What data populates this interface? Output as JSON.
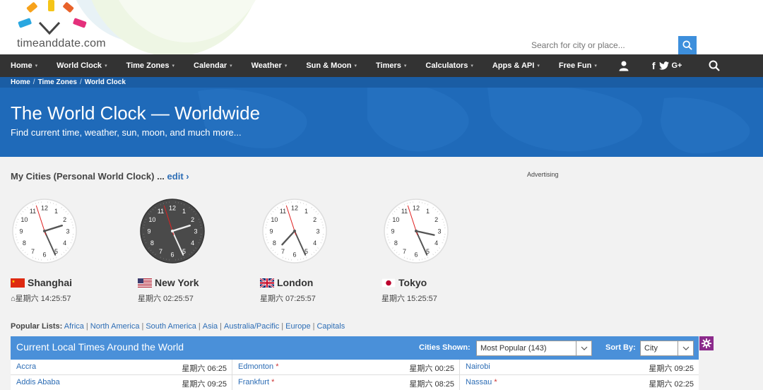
{
  "logo": {
    "text": "timeanddate.com"
  },
  "nav": {
    "items": [
      {
        "label": "Home",
        "caret": "▾"
      },
      {
        "label": "World Clock",
        "caret": "▾"
      },
      {
        "label": "Time Zones",
        "caret": "▾"
      },
      {
        "label": "Calendar",
        "caret": "▾"
      },
      {
        "label": "Weather",
        "caret": "▾"
      },
      {
        "label": "Sun & Moon",
        "caret": "▾"
      },
      {
        "label": "Timers",
        "caret": "▾"
      },
      {
        "label": "Calculators",
        "caret": "▾"
      },
      {
        "label": "Apps & API",
        "caret": "▾"
      },
      {
        "label": "Free Fun",
        "caret": "▾"
      }
    ],
    "social": [
      "f",
      "G+"
    ]
  },
  "breadcrumb": [
    "Home",
    "Time Zones",
    "World Clock"
  ],
  "banner": {
    "title": "The World Clock — Worldwide",
    "subtitle": "Find current time, weather, sun, moon, and much more...",
    "search_placeholder": "Search for city or place..."
  },
  "mycities": {
    "label": "My Cities (Personal World Clock) ...",
    "edit": "edit ›"
  },
  "advertising": "Advertising",
  "clocks": [
    {
      "city": "Shanghai",
      "time": "星期六 14:25:57",
      "home": "⌂",
      "dark": false,
      "h": 14,
      "m": 25,
      "s": 57
    },
    {
      "city": "New York",
      "time": "星期六 02:25:57",
      "dark": true,
      "h": 2,
      "m": 25,
      "s": 57
    },
    {
      "city": "London",
      "time": "星期六 07:25:57",
      "dark": false,
      "h": 7,
      "m": 25,
      "s": 57
    },
    {
      "city": "Tokyo",
      "time": "星期六 15:25:57",
      "dark": false,
      "h": 15,
      "m": 25,
      "s": 57
    }
  ],
  "popular": {
    "label": "Popular Lists:",
    "links": [
      "Africa",
      "North America",
      "South America",
      "Asia",
      "Australia/Pacific",
      "Europe",
      "Capitals"
    ]
  },
  "table": {
    "title": "Current Local Times Around the World",
    "cities_shown_label": "Cities Shown:",
    "cities_shown_value": "Most Popular (143)",
    "sort_by_label": "Sort By:",
    "sort_by_value": "City",
    "rows": [
      [
        {
          "city": "Accra",
          "dst": "",
          "time": "星期六 06:25"
        },
        {
          "city": "Edmonton",
          "dst": "*",
          "time": "星期六 00:25"
        },
        {
          "city": "Nairobi",
          "dst": "",
          "time": "星期六 09:25"
        }
      ],
      [
        {
          "city": "Addis Ababa",
          "dst": "",
          "time": "星期六 09:25"
        },
        {
          "city": "Frankfurt",
          "dst": "*",
          "time": "星期六 08:25"
        },
        {
          "city": "Nassau",
          "dst": "*",
          "time": "星期六 02:25"
        }
      ]
    ]
  }
}
